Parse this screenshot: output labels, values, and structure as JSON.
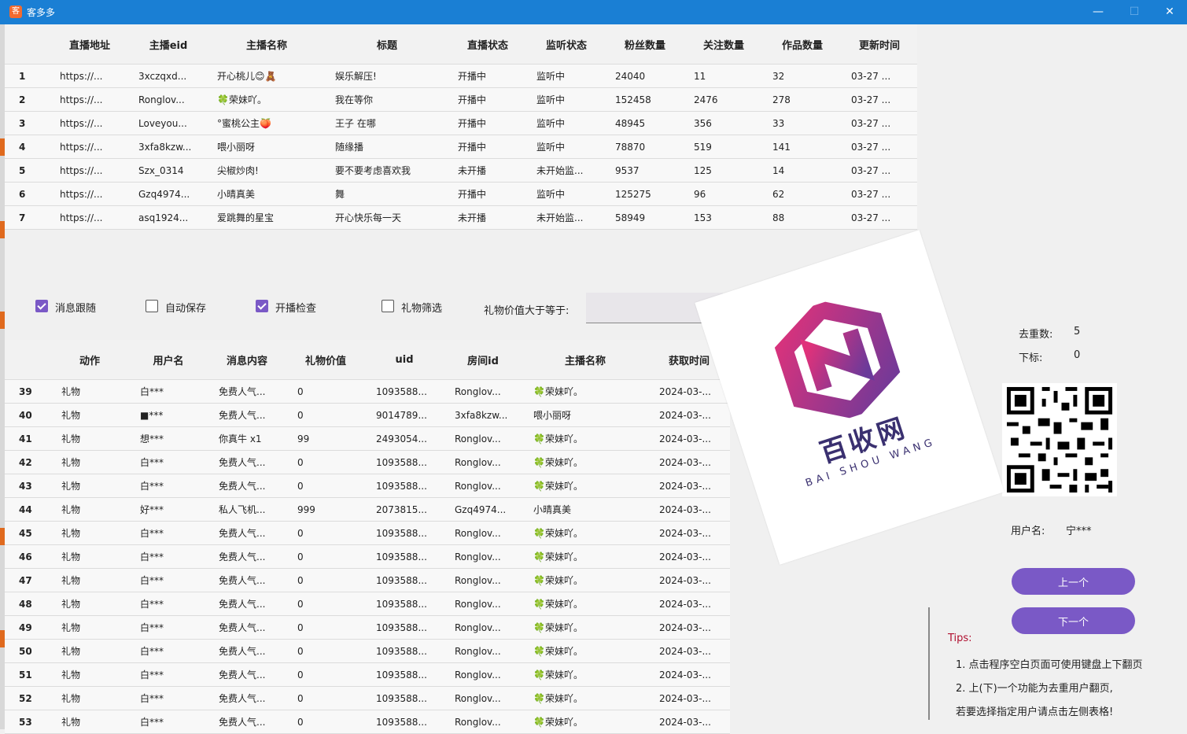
{
  "window": {
    "title": "客多多",
    "app_icon": "app-logo-icon",
    "minimize": "—",
    "maximize": "☐",
    "close": "✕"
  },
  "live_table": {
    "headers": [
      "直播地址",
      "主播eid",
      "主播名称",
      "标题",
      "直播状态",
      "监听状态",
      "粉丝数量",
      "关注数量",
      "作品数量",
      "更新时间"
    ],
    "rows": [
      [
        "1",
        "https://...",
        "3xczqxd...",
        "开心桃儿😊🧸",
        "娱乐解压!",
        "开播中",
        "监听中",
        "24040",
        "11",
        "32",
        "03-27 ..."
      ],
      [
        "2",
        "https://...",
        "Ronglov...",
        "🍀荣妹吖。",
        "我在等你",
        "开播中",
        "监听中",
        "152458",
        "2476",
        "278",
        "03-27 ..."
      ],
      [
        "3",
        "https://...",
        "Loveyou...",
        "°蜜桃公主🍑",
        "王子 在哪",
        "开播中",
        "监听中",
        "48945",
        "356",
        "33",
        "03-27 ..."
      ],
      [
        "4",
        "https://...",
        "3xfa8kzw...",
        "喂小丽呀",
        "随缘播",
        "开播中",
        "监听中",
        "78870",
        "519",
        "141",
        "03-27 ..."
      ],
      [
        "5",
        "https://...",
        "Szx_0314",
        "尖椒炒肉!",
        "要不要考虑喜欢我",
        "未开播",
        "未开始监...",
        "9537",
        "125",
        "14",
        "03-27 ..."
      ],
      [
        "6",
        "https://...",
        "Gzq4974...",
        "小晴真美",
        "舞",
        "开播中",
        "监听中",
        "125275",
        "96",
        "62",
        "03-27 ..."
      ],
      [
        "7",
        "https://...",
        "asq1924...",
        "爱跳舞的星宝",
        "开心快乐每一天",
        "未开播",
        "未开始监...",
        "58949",
        "153",
        "88",
        "03-27 ..."
      ]
    ]
  },
  "options": {
    "follow_msg": {
      "label": "消息跟随",
      "checked": true
    },
    "auto_save": {
      "label": "自动保存",
      "checked": false
    },
    "live_check": {
      "label": "开播检查",
      "checked": true
    },
    "gift_filter": {
      "label": "礼物筛选",
      "checked": false
    },
    "gift_value_label": "礼物价值大于等于:",
    "gift_value": ""
  },
  "msg_table": {
    "headers": [
      "动作",
      "用户名",
      "消息内容",
      "礼物价值",
      "uid",
      "房间id",
      "主播名称",
      "获取时间"
    ],
    "rows": [
      [
        "39",
        "礼物",
        "白***",
        "免费人气...",
        "0",
        "1093588...",
        "Ronglov...",
        "🍀荣妹吖。",
        "2024-03-..."
      ],
      [
        "40",
        "礼物",
        "■***",
        "免费人气...",
        "0",
        "9014789...",
        "3xfa8kzw...",
        "喂小丽呀",
        "2024-03-..."
      ],
      [
        "41",
        "礼物",
        "想***",
        "你真牛 x1",
        "99",
        "2493054...",
        "Ronglov...",
        "🍀荣妹吖。",
        "2024-03-..."
      ],
      [
        "42",
        "礼物",
        "白***",
        "免费人气...",
        "0",
        "1093588...",
        "Ronglov...",
        "🍀荣妹吖。",
        "2024-03-..."
      ],
      [
        "43",
        "礼物",
        "白***",
        "免费人气...",
        "0",
        "1093588...",
        "Ronglov...",
        "🍀荣妹吖。",
        "2024-03-..."
      ],
      [
        "44",
        "礼物",
        "好***",
        "私人飞机...",
        "999",
        "2073815...",
        "Gzq4974...",
        "小晴真美",
        "2024-03-..."
      ],
      [
        "45",
        "礼物",
        "白***",
        "免费人气...",
        "0",
        "1093588...",
        "Ronglov...",
        "🍀荣妹吖。",
        "2024-03-..."
      ],
      [
        "46",
        "礼物",
        "白***",
        "免费人气...",
        "0",
        "1093588...",
        "Ronglov...",
        "🍀荣妹吖。",
        "2024-03-..."
      ],
      [
        "47",
        "礼物",
        "白***",
        "免费人气...",
        "0",
        "1093588...",
        "Ronglov...",
        "🍀荣妹吖。",
        "2024-03-..."
      ],
      [
        "48",
        "礼物",
        "白***",
        "免费人气...",
        "0",
        "1093588...",
        "Ronglov...",
        "🍀荣妹吖。",
        "2024-03-..."
      ],
      [
        "49",
        "礼物",
        "白***",
        "免费人气...",
        "0",
        "1093588...",
        "Ronglov...",
        "🍀荣妹吖。",
        "2024-03-..."
      ],
      [
        "50",
        "礼物",
        "白***",
        "免费人气...",
        "0",
        "1093588...",
        "Ronglov...",
        "🍀荣妹吖。",
        "2024-03-..."
      ],
      [
        "51",
        "礼物",
        "白***",
        "免费人气...",
        "0",
        "1093588...",
        "Ronglov...",
        "🍀荣妹吖。",
        "2024-03-..."
      ],
      [
        "52",
        "礼物",
        "白***",
        "免费人气...",
        "0",
        "1093588...",
        "Ronglov...",
        "🍀荣妹吖。",
        "2024-03-..."
      ],
      [
        "53",
        "礼物",
        "白***",
        "免费人气...",
        "0",
        "1093588...",
        "Ronglov...",
        "🍀荣妹吖。",
        "2024-03-..."
      ]
    ]
  },
  "side": {
    "dedup_label": "去重数:",
    "dedup_value": "5",
    "index_label": "下标:",
    "index_value": "0",
    "qr_icon": "qr-code-icon",
    "username_label": "用户名:",
    "username_value": "宁***",
    "prev_btn": "上一个",
    "next_btn": "下一个",
    "tips_title": "Tips:",
    "tip1": "1. 点击程序空白页面可使用键盘上下翻页",
    "tip2": "2. 上(下)一个功能为去重用户翻页,",
    "tip3": "若要选择指定用户请点击左侧表格!"
  },
  "watermark": {
    "cn": "百收网",
    "en": "BAI SHOU WANG",
    "logo": "baishouwang-logo-icon"
  },
  "colors": {
    "titlebar": "#1a7fd4",
    "accent": "#7a59c6",
    "tips": "#b01030"
  }
}
